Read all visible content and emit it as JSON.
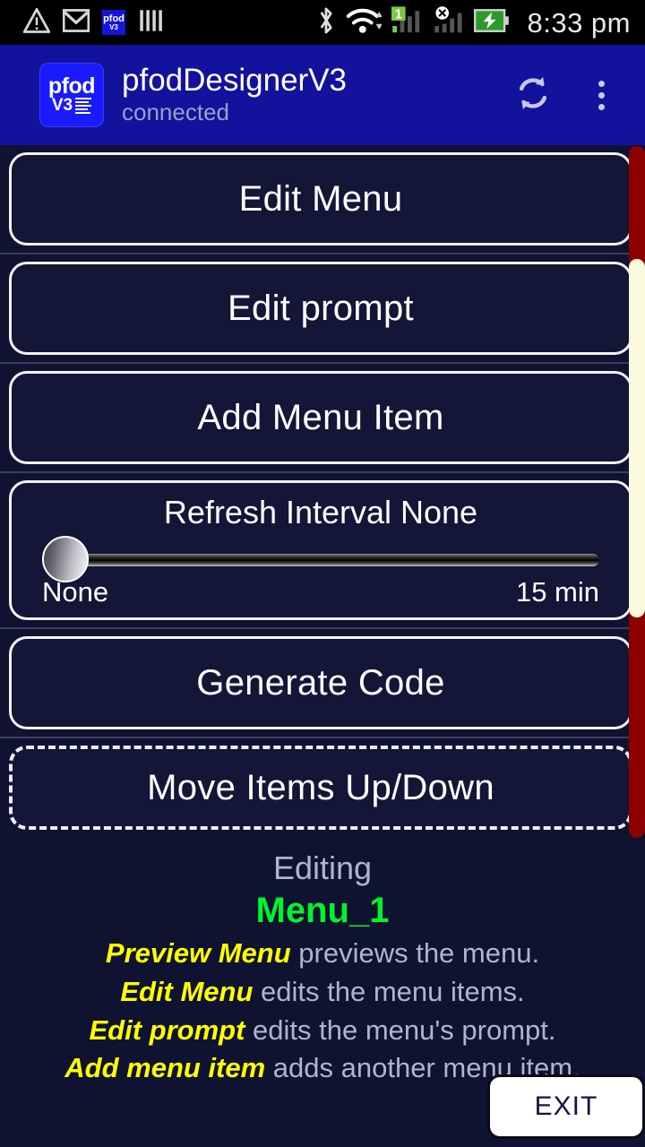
{
  "statusbar": {
    "time": "8:33 pm",
    "icons": [
      {
        "name": "warning-icon",
        "glyph": "triangle-exclamation"
      },
      {
        "name": "gmail-icon",
        "glyph": "envelope-m"
      },
      {
        "name": "pfod-notification-icon",
        "line1": "pfod",
        "line2": "V3"
      },
      {
        "name": "bars-icon",
        "glyph": "vertical-bars"
      }
    ],
    "right_icons": [
      {
        "name": "bluetooth-icon"
      },
      {
        "name": "wifi-icon"
      },
      {
        "name": "sim1-signal-icon",
        "badge": "1"
      },
      {
        "name": "sim2-no-service-icon",
        "badge": "x"
      },
      {
        "name": "battery-charging-icon"
      }
    ]
  },
  "appbar": {
    "logo": {
      "line1": "pfod",
      "line2": "V3"
    },
    "title": "pfodDesignerV3",
    "subtitle": "connected",
    "refresh_label": "refresh",
    "overflow_label": "more options"
  },
  "menu": {
    "items": [
      {
        "id": "edit-menu",
        "label": "Edit Menu",
        "type": "button"
      },
      {
        "id": "edit-prompt",
        "label": "Edit prompt",
        "type": "button"
      },
      {
        "id": "add-menu-item",
        "label": "Add Menu Item",
        "type": "button"
      },
      {
        "id": "refresh-interval",
        "label": "Refresh Interval None",
        "type": "slider"
      },
      {
        "id": "generate-code",
        "label": "Generate Code",
        "type": "button"
      },
      {
        "id": "move-items",
        "label": "Move Items Up/Down",
        "type": "dashed-button"
      }
    ]
  },
  "slider": {
    "title": "Refresh Interval None",
    "min_label": "None",
    "max_label": "15 min",
    "value": 0,
    "min": 0,
    "max": 100
  },
  "footer": {
    "editing_label": "Editing",
    "menu_name": "Menu_1",
    "hints": [
      {
        "em": "Preview Menu",
        "rest": " previews the menu."
      },
      {
        "em": "Edit Menu",
        "rest": " edits the menu items."
      },
      {
        "em": "Edit prompt",
        "rest": " edits the menu's prompt."
      },
      {
        "em": "Add menu item",
        "rest": " adds another menu item."
      }
    ]
  },
  "exit": {
    "label": "EXIT"
  },
  "colors": {
    "background": "#0f1230",
    "appbar": "#12129c",
    "button_border": "#f2f2f5",
    "scrollbar_track": "#8d0000",
    "scrollbar_thumb": "#fcfade",
    "accent_green": "#00f52a",
    "accent_yellow": "#ffff00",
    "muted_text": "#b0b4cc"
  }
}
